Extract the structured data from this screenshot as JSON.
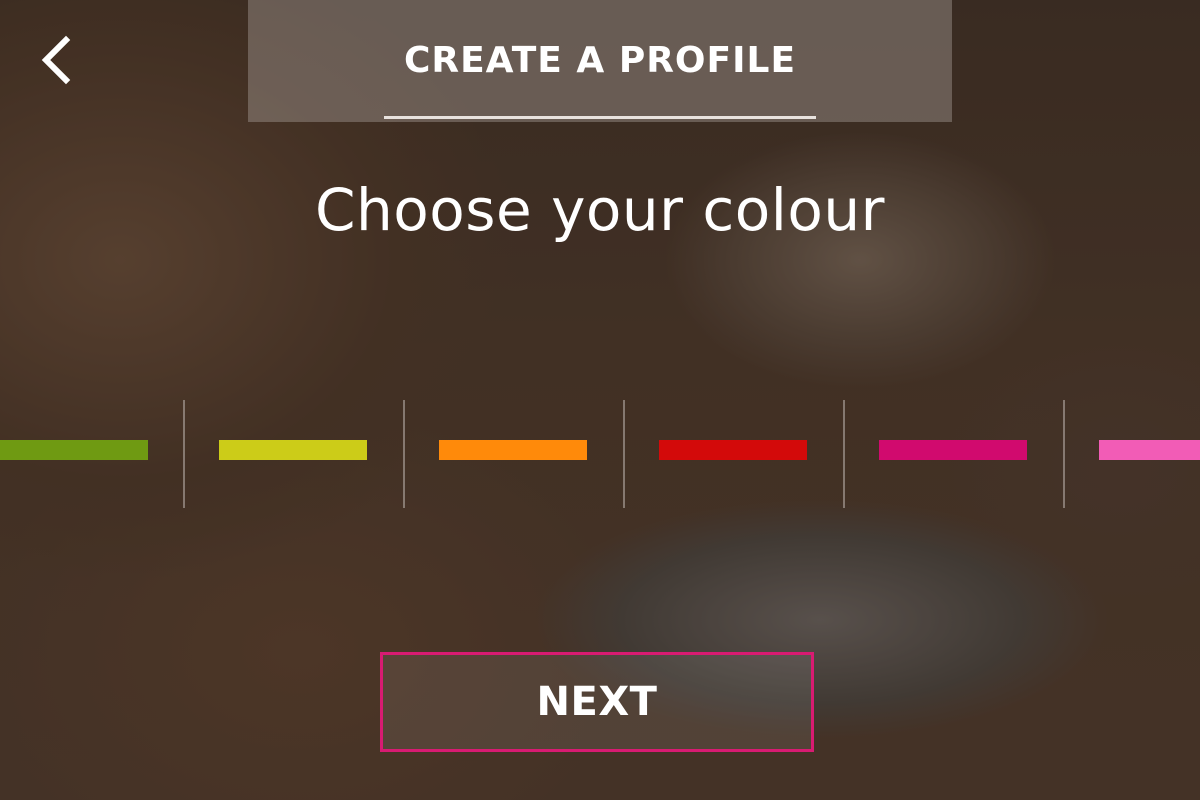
{
  "header": {
    "title": "CREATE A PROFILE",
    "back_icon": "chevron-left-icon"
  },
  "main": {
    "heading": "Choose your colour",
    "colours": [
      {
        "name": "green",
        "hex": "#6f9a12"
      },
      {
        "name": "yellow",
        "hex": "#cccc18"
      },
      {
        "name": "orange",
        "hex": "#ff8a0a"
      },
      {
        "name": "red",
        "hex": "#d30a0a"
      },
      {
        "name": "magenta",
        "hex": "#d10a6e"
      },
      {
        "name": "pink",
        "hex": "#f25cb6"
      }
    ],
    "selected_colour": "magenta"
  },
  "footer": {
    "next_label": "NEXT",
    "accent": "#d81b72"
  }
}
